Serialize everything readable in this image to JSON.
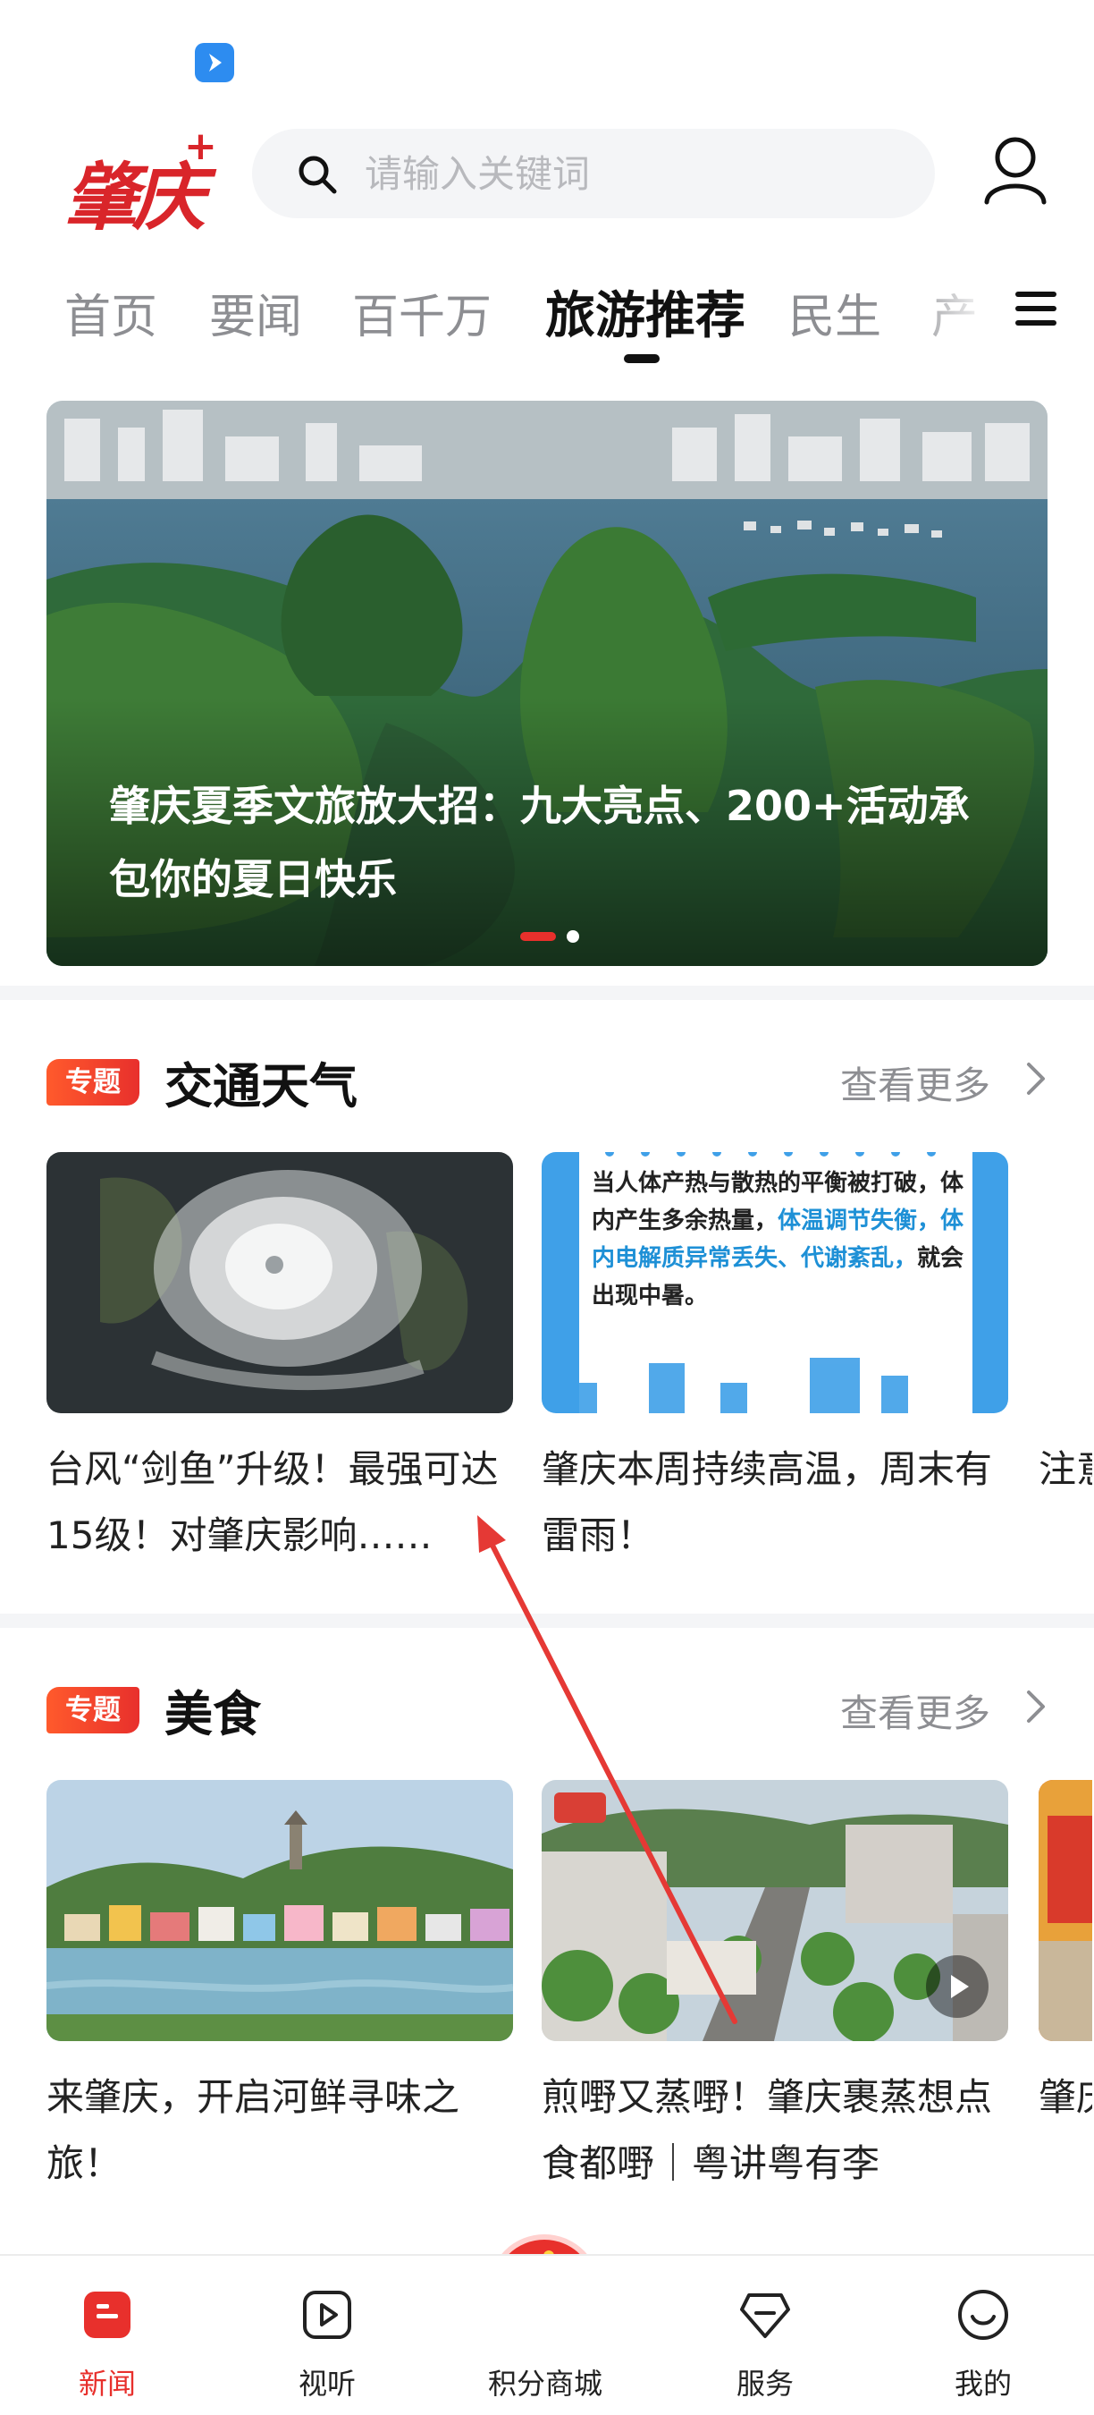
{
  "header": {
    "logo_text": "肇庆",
    "logo_plus": "+",
    "search_placeholder": "请输入关键词"
  },
  "tabs": [
    {
      "label": "首页"
    },
    {
      "label": "要闻"
    },
    {
      "label": "百千万"
    },
    {
      "label": "旅游推荐",
      "active": true
    },
    {
      "label": "民生"
    },
    {
      "label": "产"
    }
  ],
  "hero": {
    "title": "肇庆夏季文旅放大招：九大亮点、200+活动承包你的夏日快乐",
    "slide_index": 1,
    "slide_count": 2
  },
  "sections": [
    {
      "badge": "专题",
      "title": "交通天气",
      "more": "查看更多",
      "cards": [
        {
          "title": "台风“剑鱼”升级！最强可达15级！对肇庆影响……"
        },
        {
          "title": "肇庆本周持续高温，周末有雷雨！",
          "image_text_1": "当人体产热与散热的平衡被打破，体内产生多余热量，",
          "image_text_2": "体温调节失衡，体内电解质异常丢失、代谢紊乱，",
          "image_text_3": "就会出现中暑。"
        },
        {
          "title": "注意施交"
        }
      ]
    },
    {
      "badge": "专题",
      "title": "美食",
      "more": "查看更多",
      "cards": [
        {
          "title": "来肇庆，开启河鲜寻味之旅！"
        },
        {
          "title": "煎嘢又蒸嘢！肇庆裹蒸想点食都嘢｜粤讲粤有李"
        },
        {
          "title": "肇庆香港"
        }
      ]
    }
  ],
  "bottom_nav": [
    {
      "label": "新闻",
      "icon": "news-icon",
      "active": true
    },
    {
      "label": "视听",
      "icon": "video-icon"
    },
    {
      "label": "积分商城",
      "icon": "shopping-cart-icon"
    },
    {
      "label": "服务",
      "icon": "service-icon"
    },
    {
      "label": "我的",
      "icon": "smile-icon"
    }
  ],
  "colors": {
    "accent": "#e8302c",
    "tab_active": "#111111",
    "tab_inactive": "#8d8e92",
    "annotation_arrow": "#e53935"
  }
}
